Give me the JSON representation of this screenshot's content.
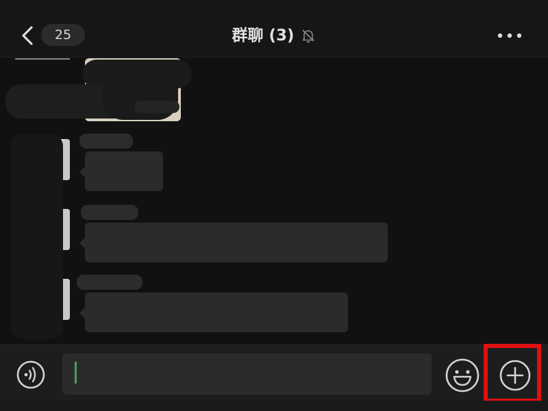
{
  "header": {
    "back_icon": "chevron-left-icon",
    "unread_count": "25",
    "title": "群聊 (3)",
    "mute_icon": "bell-off-icon",
    "more_icon": "more-dots-icon"
  },
  "input_bar": {
    "voice_icon": "voice-icon",
    "message_value": "",
    "emoji_icon": "emoji-icon",
    "plus_icon": "plus-icon"
  },
  "colors": {
    "background": "#111111",
    "header": "#161616",
    "bubble": "#2b2b2b",
    "caret": "#4ca05a",
    "highlight": "#e01010"
  }
}
